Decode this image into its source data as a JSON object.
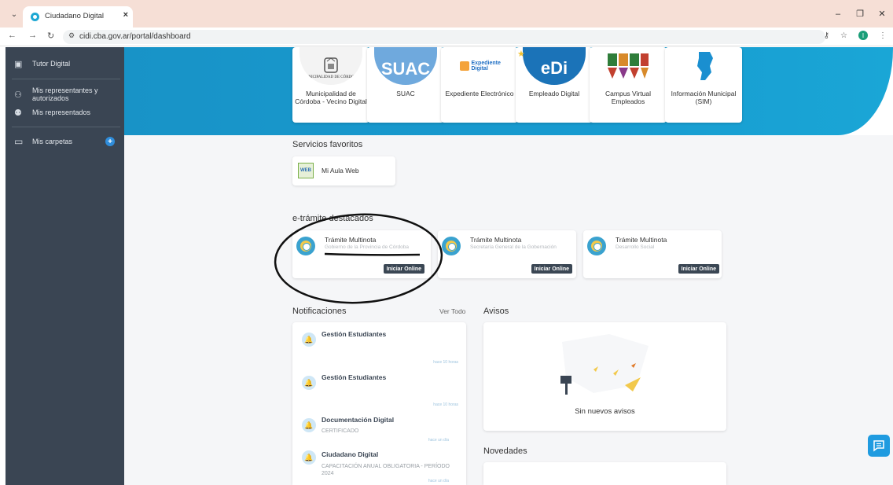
{
  "browser": {
    "tab_title": "Ciudadano Digital",
    "tab_close": "×",
    "tab_menu": "⌄",
    "url": "cidi.cba.gov.ar/portal/dashboard",
    "profile_initial": "I"
  },
  "sidebar": {
    "items": [
      {
        "label": "Tutor Digital",
        "icon": "id-card-icon"
      },
      {
        "label": "Mis representantes y autorizados",
        "icon": "users-icon"
      },
      {
        "label": "Mis representados",
        "icon": "user-voice-icon"
      },
      {
        "label": "Mis carpetas",
        "icon": "folder-icon"
      }
    ]
  },
  "services": [
    {
      "label": "Municipalidad de Córdoba - Vecino Digital",
      "logo_text": "MUNICIPALIDAD DE CÓRDOBA"
    },
    {
      "label": "SUAC",
      "logo_text": "SUAC"
    },
    {
      "label": "Expediente Electrónico",
      "logo_text": "Expediente Digital"
    },
    {
      "label": "Empleado Digital",
      "logo_text": "eDi"
    },
    {
      "label": "Campus Virtual Empleados",
      "logo_text": ""
    },
    {
      "label": "Información Municipal (SIM)",
      "logo_text": ""
    }
  ],
  "favoritos": {
    "title": "Servicios favoritos",
    "items": [
      {
        "label": "Mi Aula Web"
      }
    ]
  },
  "tramites": {
    "title": "e-trámite destacados",
    "items": [
      {
        "title": "Trámite Multinota",
        "subtitle": "Gobierno de la Provincia de Córdoba",
        "button": "Iniciar Online"
      },
      {
        "title": "Trámite Multinota",
        "subtitle": "Secretaría General de la Gobernación",
        "button": "Iniciar Online"
      },
      {
        "title": "Trámite Multinota",
        "subtitle": "Desarrollo Social",
        "button": "Iniciar Online"
      }
    ]
  },
  "notificaciones": {
    "title": "Notificaciones",
    "see_all": "Ver Todo",
    "items": [
      {
        "title": "Gestión Estudiantes",
        "body": "",
        "time": "hace 10 horas"
      },
      {
        "title": "Gestión Estudiantes",
        "body": "",
        "time": "hace 10 horas"
      },
      {
        "title": "Documentación Digital",
        "body": "CERTIFICADO",
        "time": "hace un día"
      },
      {
        "title": "Ciudadano Digital",
        "body": "CAPACITACIÓN ANUAL OBLIGATORIA - PERÍODO 2024",
        "time": "hace un día"
      }
    ]
  },
  "avisos": {
    "title": "Avisos",
    "empty_text": "Sin nuevos avisos"
  },
  "novedades": {
    "title": "Novedades"
  },
  "colors": {
    "brand_blue": "#1893c7",
    "sidebar_bg": "#3a4553",
    "button_dark": "#3b4754"
  }
}
